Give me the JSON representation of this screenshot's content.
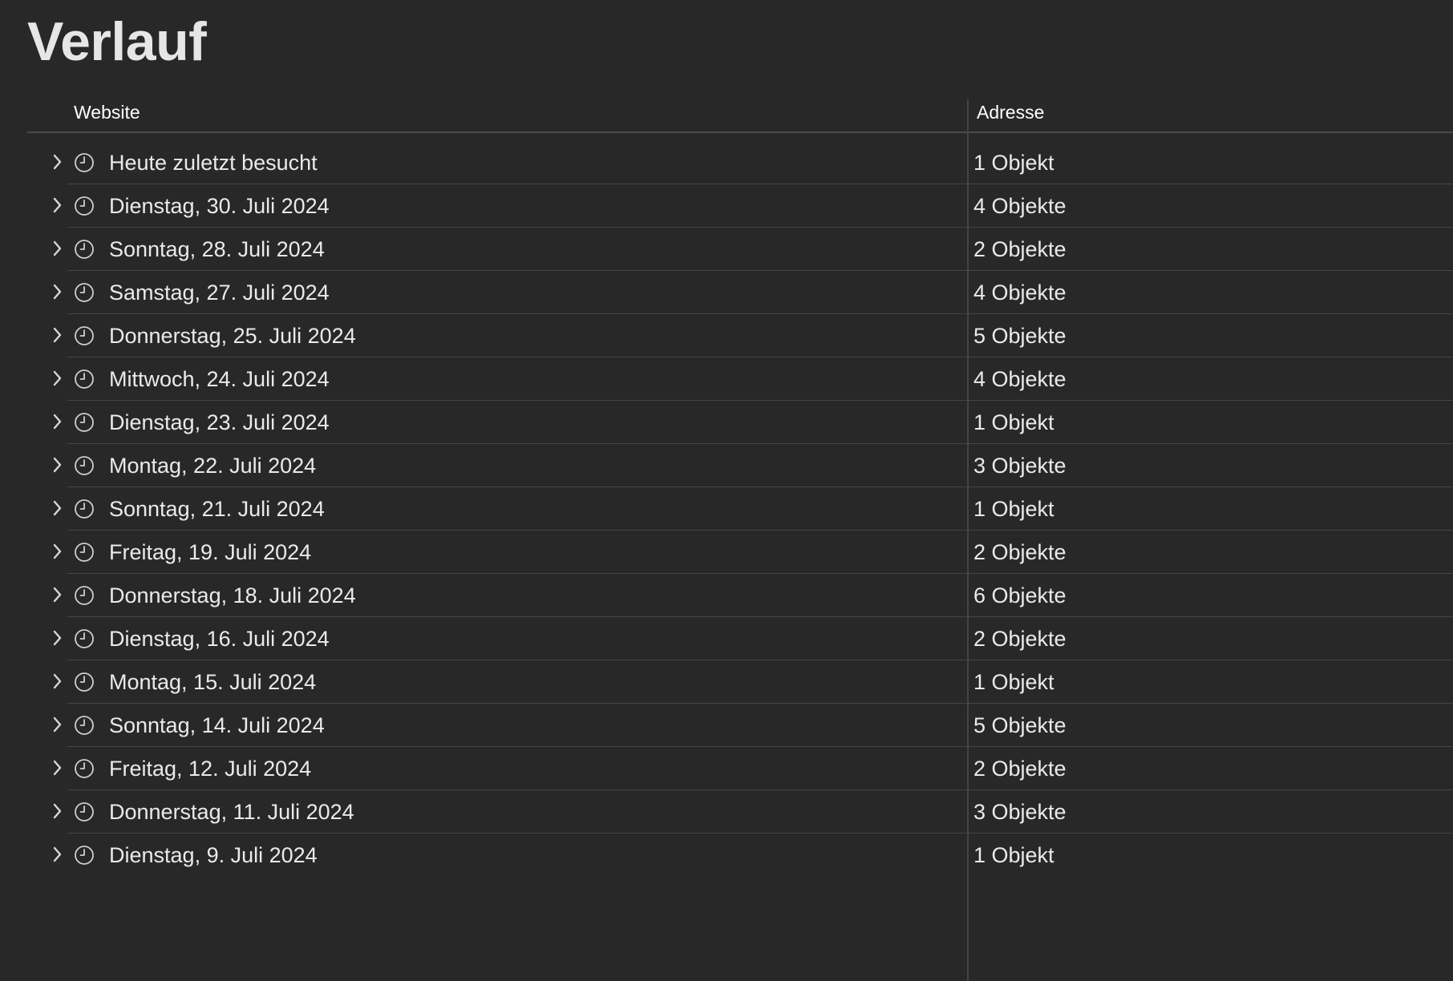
{
  "page": {
    "title": "Verlauf"
  },
  "columns": {
    "website": "Website",
    "address": "Adresse"
  },
  "icons": {
    "disclosure": "chevron-right-icon",
    "entry": "clock-icon"
  },
  "colors": {
    "background": "#282828",
    "text": "#eaeaea",
    "separator": "#464646"
  },
  "history": [
    {
      "label": "Heute zuletzt besucht",
      "count": "1 Objekt"
    },
    {
      "label": "Dienstag, 30. Juli 2024",
      "count": "4 Objekte"
    },
    {
      "label": "Sonntag, 28. Juli 2024",
      "count": "2 Objekte"
    },
    {
      "label": "Samstag, 27. Juli 2024",
      "count": "4 Objekte"
    },
    {
      "label": "Donnerstag, 25. Juli 2024",
      "count": "5 Objekte"
    },
    {
      "label": "Mittwoch, 24. Juli 2024",
      "count": "4 Objekte"
    },
    {
      "label": "Dienstag, 23. Juli 2024",
      "count": "1 Objekt"
    },
    {
      "label": "Montag, 22. Juli 2024",
      "count": "3 Objekte"
    },
    {
      "label": "Sonntag, 21. Juli 2024",
      "count": "1 Objekt"
    },
    {
      "label": "Freitag, 19. Juli 2024",
      "count": "2 Objekte"
    },
    {
      "label": "Donnerstag, 18. Juli 2024",
      "count": "6 Objekte"
    },
    {
      "label": "Dienstag, 16. Juli 2024",
      "count": "2 Objekte"
    },
    {
      "label": "Montag, 15. Juli 2024",
      "count": "1 Objekt"
    },
    {
      "label": "Sonntag, 14. Juli 2024",
      "count": "5 Objekte"
    },
    {
      "label": "Freitag, 12. Juli 2024",
      "count": "2 Objekte"
    },
    {
      "label": "Donnerstag, 11. Juli 2024",
      "count": "3 Objekte"
    },
    {
      "label": "Dienstag, 9. Juli 2024",
      "count": "1 Objekt"
    }
  ]
}
